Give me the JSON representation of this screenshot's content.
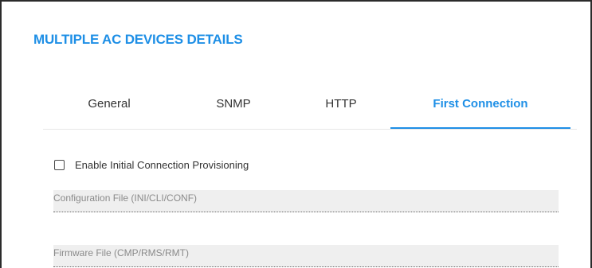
{
  "dialog": {
    "title": "MULTIPLE AC DEVICES DETAILS"
  },
  "tabs": [
    {
      "label": "General",
      "active": false
    },
    {
      "label": "SNMP",
      "active": false
    },
    {
      "label": "HTTP",
      "active": false
    },
    {
      "label": "First Connection",
      "active": true
    }
  ],
  "first_connection": {
    "enable_checkbox": {
      "label": "Enable Initial Connection Provisioning",
      "checked": false
    },
    "configuration_file": {
      "placeholder": "Configuration File (INI/CLI/CONF)",
      "value": ""
    },
    "firmware_file": {
      "placeholder": "Firmware File (CMP/RMS/RMT)",
      "value": ""
    }
  },
  "colors": {
    "accent": "#1e8fe6",
    "field_background": "#efefef",
    "text": "#333333",
    "placeholder": "#8a8a8a"
  }
}
